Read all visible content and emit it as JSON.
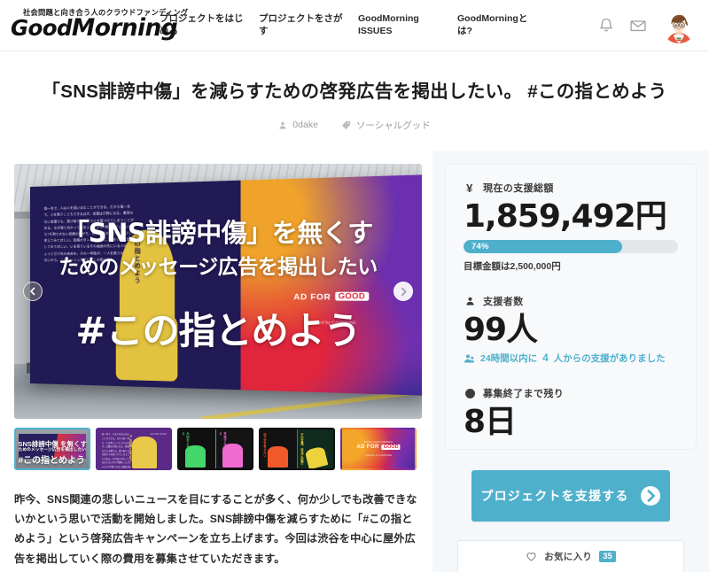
{
  "header": {
    "brand": {
      "tagline": "社会問題と向き合う人のクラウドファンディング",
      "logo_good": "Good",
      "logo_morning": "Morning"
    },
    "nav_items": [
      {
        "label": "プロジェクトをはじめる",
        "name": "nav-start-project"
      },
      {
        "label": "プロジェクトをさがす",
        "name": "nav-find-project"
      },
      {
        "label": "GoodMorning ISSUES",
        "name": "nav-issues"
      },
      {
        "label": "GoodMorningとは?",
        "name": "nav-about"
      }
    ],
    "icons": {
      "bell": "bell-icon",
      "mail": "mail-icon",
      "avatar": "user-avatar"
    }
  },
  "project": {
    "title": "「SNS誹謗中傷」を減らすための啓発広告を掲出したい。 #この指とめよう",
    "author": "0dake",
    "category": "ソーシャルグッド",
    "description": "昨今、SNS関連の悲しいニュースを目にすることが多く、何か少しでも改善できないかという思いで活動を開始しました。SNS誹謗中傷を減らすために「#この指とめよう」という啓発広告キャンペーンを立ち上げます。今回は渋谷を中心に屋外広告を掲出していく際の費用を募集させていただきます。"
  },
  "carousel": {
    "overlay_line1": "「SNS誹謗中傷」を無くす",
    "overlay_line2": "ためのメッセージ広告を掲出したい",
    "overlay_line3": "#この指とめよう",
    "prev_label": "前の画像",
    "next_label": "次の画像",
    "billboard_copy": "指一本で、人は人を追い込むことができる。だから指一本で、人を救うこともできるはず。言葉は刃物になる。悪意のない言葉でも、受け取り方次第で人を傷つけてしまうことがある。なぜ面と向かっては言えないから?想像していないから?予測できない投稿の拡がり。何かを書き込む前に、少し考えてみてほしい。投稿ボタンを押す前に、指をとめて想像してみてほしい。いま見ているその画面の先にいる人の、ちょっとだけ先の未来を。その一呼吸が、一人を救うかもしれないから。このハッシュタグに、この指とまれ。",
    "billboard_vertical": "#この指とめよう",
    "ad_for_good_text": "AD FOR",
    "ad_for_good_badge": "GOOD",
    "ad_for_good_sub": "Powered by CAMPFIRE",
    "thumbnails": [
      {
        "name": "thumb-billboard-station",
        "active": true,
        "l1": "SNS誹謗中傷 を無くす",
        "l2": "ためのメッセージ広告を掲出したい",
        "l3": "#この指とめよう"
      },
      {
        "name": "thumb-purple-hand",
        "active": false,
        "vertical": "#この指とめよう",
        "tag": "AD FOR GOOD"
      },
      {
        "name": "thumb-green-pink-hands",
        "active": false,
        "v_green": "大切な人を守りたいから",
        "v_pink": "見逃さないで欲しいから"
      },
      {
        "name": "thumb-orange-yellow-hands",
        "active": false,
        "v_orange": "伝え方を考えたい",
        "v_yellow": "その言葉、本当に必要?"
      },
      {
        "name": "thumb-ad-for-good",
        "active": false,
        "text": "AD FOR",
        "badge": "GOOD",
        "top": "SOCIAL GOOD CAMPAIGN",
        "bottom": "Powered by CAMPFIRE"
      }
    ]
  },
  "stats": {
    "amount_label": "現在の支援総額",
    "amount_value": "1,859,492円",
    "progress_percent": "74%",
    "progress_value": 74,
    "goal_text": "目標金額は2,500,000円",
    "supporters_label": "支援者数",
    "supporters_value": "99人",
    "recent_note_pre": "24時間以内に",
    "recent_note_count": "4",
    "recent_note_post": "人からの支援がありました",
    "deadline_label": "募集終了まで残り",
    "deadline_value": "8日",
    "yen_symbol": "¥"
  },
  "actions": {
    "support_label": "プロジェクトを支援する",
    "favorite_label": "お気に入り",
    "favorite_count": "35"
  },
  "colors": {
    "accent": "#4fb0cc",
    "panel_bg": "#f5f8fa",
    "card_bg": "#f7f9fb",
    "text": "#2b2b2b"
  }
}
